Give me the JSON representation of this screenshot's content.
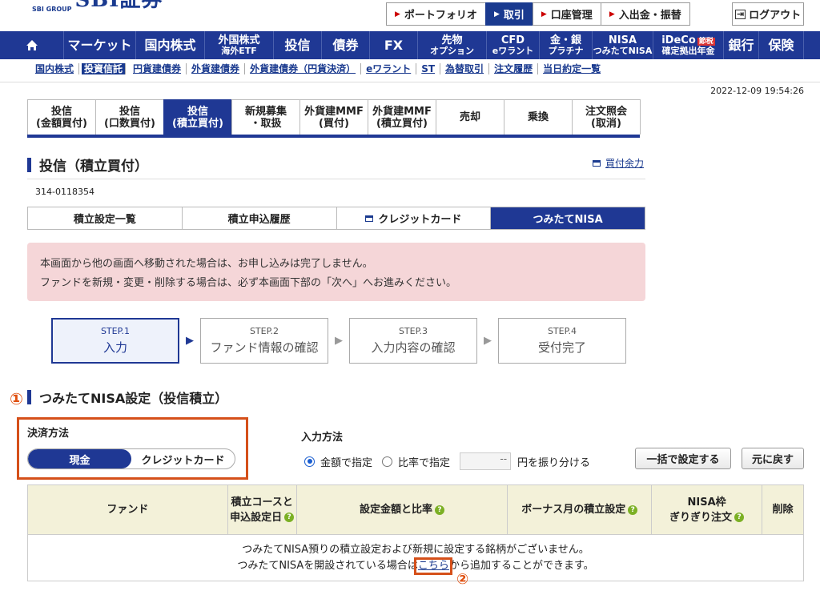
{
  "logo": {
    "small": "SBI GROUP",
    "brand": "SBI証券"
  },
  "top_links": [
    {
      "label": "ポートフォリオ",
      "active": false
    },
    {
      "label": "取引",
      "active": true
    },
    {
      "label": "口座管理",
      "active": false
    },
    {
      "label": "入出金・振替",
      "active": false
    }
  ],
  "logout": "ログアウト",
  "nav": [
    {
      "label": "マーケット"
    },
    {
      "label": "国内株式"
    },
    {
      "label": "外国株式",
      "sub": "海外ETF"
    },
    {
      "label": "投信"
    },
    {
      "label": "債券"
    },
    {
      "label": "FX"
    },
    {
      "label": "先物",
      "sub": "オプション"
    },
    {
      "label": "CFD",
      "sub": "eワラント"
    },
    {
      "label": "金・銀",
      "sub": "プラチナ"
    },
    {
      "label": "NISA",
      "sub": "つみたてNISA"
    },
    {
      "label": "iDeCo",
      "sub": "確定拠出年金",
      "badge": "節税"
    },
    {
      "label": "銀行"
    },
    {
      "label": "保険"
    }
  ],
  "subnav": [
    "国内株式",
    "投資信託",
    "円貨建債券",
    "外貨建債券",
    "外貨建債券（円貨決済）",
    "eワラント",
    "ST",
    "為替取引",
    "注文履歴",
    "当日約定一覧"
  ],
  "subnav_selected": "投資信託",
  "timestamp": "2022-12-09 19:54:26",
  "tabs": [
    {
      "label": "投信\n(金額買付)",
      "active": false
    },
    {
      "label": "投信\n(口数買付)",
      "active": false
    },
    {
      "label": "投信\n(積立買付)",
      "active": true
    },
    {
      "label": "新規募集\n・取扱",
      "active": false
    },
    {
      "label": "外貨建MMF\n(買付)",
      "active": false
    },
    {
      "label": "外貨建MMF\n(積立買付)",
      "active": false
    },
    {
      "label": "売却",
      "active": false
    },
    {
      "label": "乗換",
      "active": false
    },
    {
      "label": "注文照会\n(取消)",
      "active": false
    }
  ],
  "page_title": "投信（積立買付）",
  "buying_power": "買付余力",
  "account_number": "314-0118354",
  "subtabs": [
    {
      "label": "積立設定一覧",
      "active": false
    },
    {
      "label": "積立申込履歴",
      "active": false
    },
    {
      "label": "クレジットカード",
      "active": false,
      "icon": true
    },
    {
      "label": "つみたてNISA",
      "active": true
    }
  ],
  "notice": [
    "本画面から他の画面へ移動された場合は、お申し込みは完了しません。",
    "ファンドを新規・変更・削除する場合は、必ず本画面下部の「次へ」へお進みください。"
  ],
  "steps": [
    {
      "num": "STEP.1",
      "label": "入力",
      "active": true
    },
    {
      "num": "STEP.2",
      "label": "ファンド情報の確認",
      "active": false
    },
    {
      "num": "STEP.3",
      "label": "入力内容の確認",
      "active": false
    },
    {
      "num": "STEP.4",
      "label": "受付完了",
      "active": false
    }
  ],
  "annotation_1": "①",
  "annotation_2": "②",
  "section_title": "つみたてNISA設定（投信積立）",
  "payment": {
    "label": "決済方法",
    "options": [
      "現金",
      "クレジットカード"
    ],
    "selected": "現金"
  },
  "input_method": {
    "label": "入力方法",
    "option_amount": "金額で指定",
    "option_ratio": "比率で指定",
    "selected": "金額で指定",
    "ratio_value": "--",
    "distribute_text": "円を振り分ける"
  },
  "buttons": {
    "bulk_set": "一括で設定する",
    "reset": "元に戻す"
  },
  "table": {
    "headers": [
      "ファンド",
      "積立コースと\n申込設定日",
      "設定金額と比率",
      "ボーナス月の積立設定",
      "NISA枠\nぎりぎり注文",
      "削除"
    ],
    "empty_line1": "つみたてNISA預りの積立設定および新規に設定する銘柄がございません。",
    "empty_line2_pre": "つみたてNISAを開設されている場合は",
    "empty_link": "こちら",
    "empty_line2_post": "から追加することができます。"
  },
  "colors": {
    "navy": "#1f3894",
    "annotation": "#d5501a",
    "notice_bg": "#f5d6d8",
    "help_green": "#7bb024"
  }
}
